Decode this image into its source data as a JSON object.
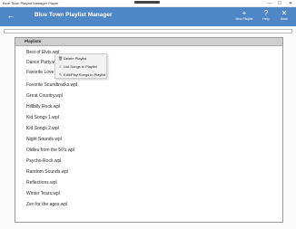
{
  "window": {
    "title": "Blue Town Playlist Manager Player",
    "minimize": "—",
    "maximize": "☐",
    "close": "✕"
  },
  "header": {
    "back_icon": "←",
    "title": "Blue Town Playlist Manager",
    "commands": [
      {
        "icon": "+",
        "label": "New Playlist"
      },
      {
        "icon": "?",
        "label": "Help"
      },
      {
        "icon": "✕",
        "label": "Back"
      }
    ]
  },
  "search": {
    "value": "",
    "placeholder": ""
  },
  "playlists": {
    "header": "Playlists",
    "items": [
      "Best of Elvis.wpl",
      "Dance Party.wpl",
      "Favorite Love Songs.wpl",
      "Favorite Soundtracks.wpl",
      "Great Country.wpl",
      "Hillbilly Rock.wpl",
      "Kid Songs 1.wpl",
      "Kid Songs 2.wpl",
      "Night Sounds.wpl",
      "Oldies from the 50's.wpl",
      "Psycho-Rock.wpl",
      "Random Sounds.wpl",
      "Reflections.wpl",
      "Winter Tears.wpl",
      "Zen for the ages.wpl"
    ]
  },
  "context_menu": {
    "items": [
      {
        "icon": "🗑",
        "label": "Delete Playlist"
      },
      {
        "icon": "≡",
        "label": "List Songs in Playlist"
      },
      {
        "icon": "✎",
        "label": "Edit/Play Songs in Playlist"
      }
    ]
  }
}
